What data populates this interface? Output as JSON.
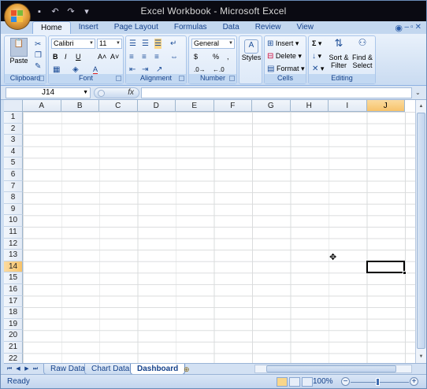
{
  "window": {
    "title": "Excel Workbook - Microsoft Excel",
    "office_button": "office-button"
  },
  "qat": {
    "save": "💾",
    "undo": "↶",
    "redo": "↷"
  },
  "ribbon_tabs": [
    "Home",
    "Insert",
    "Page Layout",
    "Formulas",
    "Data",
    "Review",
    "View"
  ],
  "clipboard": {
    "paste": "Paste",
    "label": "Clipboard"
  },
  "font": {
    "name": "Calibri",
    "size": "11",
    "label": "Font",
    "bold": "B",
    "italic": "I",
    "underline": "U",
    "grow": "A˄",
    "shrink": "A˅",
    "fill": "A"
  },
  "alignment": {
    "label": "Alignment"
  },
  "number": {
    "format": "General",
    "currency": "$",
    "percent": "%",
    "comma": ",",
    "inc": ".0→",
    "dec": "←.0",
    "label": "Number"
  },
  "styles": {
    "label": "Styles"
  },
  "cells": {
    "insert": "Insert",
    "delete": "Delete",
    "format": "Format",
    "label": "Cells"
  },
  "editing": {
    "sum": "Σ",
    "fill": "↓",
    "clear": "✕",
    "sort": "Sort &",
    "sort2": "Filter",
    "find": "Find &",
    "find2": "Select",
    "label": "Editing"
  },
  "formula_bar": {
    "name_box": "J14",
    "fx": "fx",
    "value": ""
  },
  "columns": [
    "A",
    "B",
    "C",
    "D",
    "E",
    "F",
    "G",
    "H",
    "I",
    "J"
  ],
  "rows": [
    "1",
    "2",
    "3",
    "4",
    "5",
    "6",
    "7",
    "8",
    "9",
    "10",
    "11",
    "12",
    "13",
    "14",
    "15",
    "16",
    "17",
    "18",
    "19",
    "20",
    "21",
    "22"
  ],
  "selected": {
    "column": "J",
    "row": "14"
  },
  "sheets": [
    "Raw Data",
    "Chart Data",
    "Dashboard"
  ],
  "active_sheet": "Dashboard",
  "status": {
    "ready": "Ready",
    "zoom": "100%"
  }
}
